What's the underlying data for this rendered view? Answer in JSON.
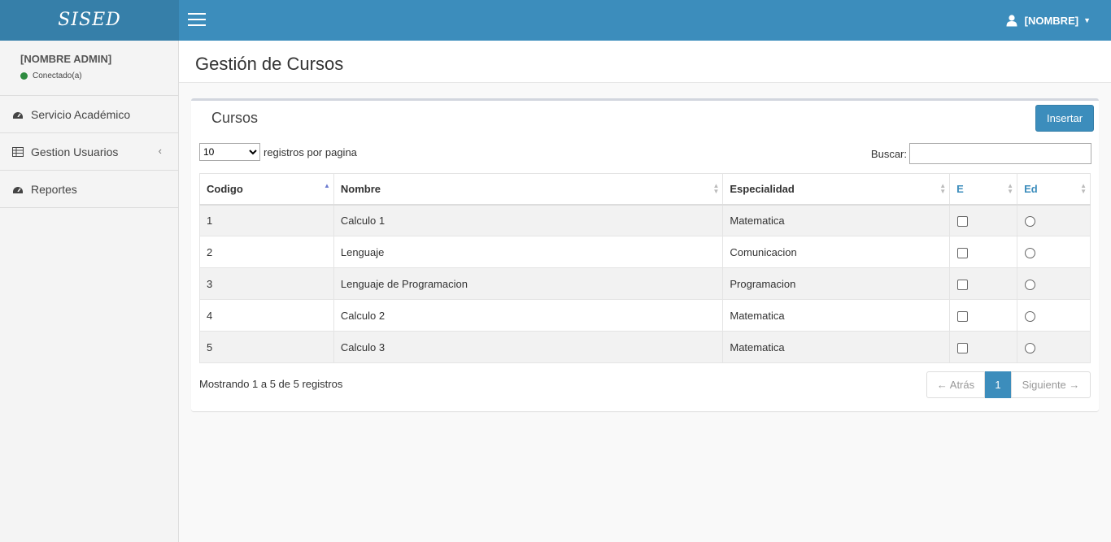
{
  "header": {
    "logo": "SISED",
    "user_name": "[NOMBRE]",
    "brand_color": "#3c8dbc"
  },
  "sidebar": {
    "admin_name": "[NOMBRE ADMIN]",
    "status": "Conectado(a)",
    "items": [
      {
        "label": "Servicio Académico",
        "icon": "dashboard-icon"
      },
      {
        "label": "Gestion Usuarios",
        "icon": "table-icon"
      },
      {
        "label": "Reportes",
        "icon": "dashboard-icon"
      }
    ]
  },
  "page": {
    "title": "Gestión de Cursos"
  },
  "box": {
    "title": "Cursos",
    "insert_label": "Insertar",
    "length_value": "10",
    "length_suffix": "registros por pagina",
    "search_label": "Buscar:",
    "search_value": ""
  },
  "table": {
    "columns": [
      "Codigo",
      "Nombre",
      "Especialidad",
      "E",
      "Ed"
    ],
    "rows": [
      {
        "codigo": "1",
        "nombre": "Calculo 1",
        "especialidad": "Matematica"
      },
      {
        "codigo": "2",
        "nombre": "Lenguaje",
        "especialidad": "Comunicacion"
      },
      {
        "codigo": "3",
        "nombre": "Lenguaje de Programacion",
        "especialidad": "Programacion"
      },
      {
        "codigo": "4",
        "nombre": "Calculo 2",
        "especialidad": "Matematica"
      },
      {
        "codigo": "5",
        "nombre": "Calculo 3",
        "especialidad": "Matematica"
      }
    ]
  },
  "footer": {
    "info": "Mostrando 1 a 5 de 5 registros",
    "prev_label": "← Atrás",
    "current_page": "1",
    "next_label": "Siguiente →"
  }
}
